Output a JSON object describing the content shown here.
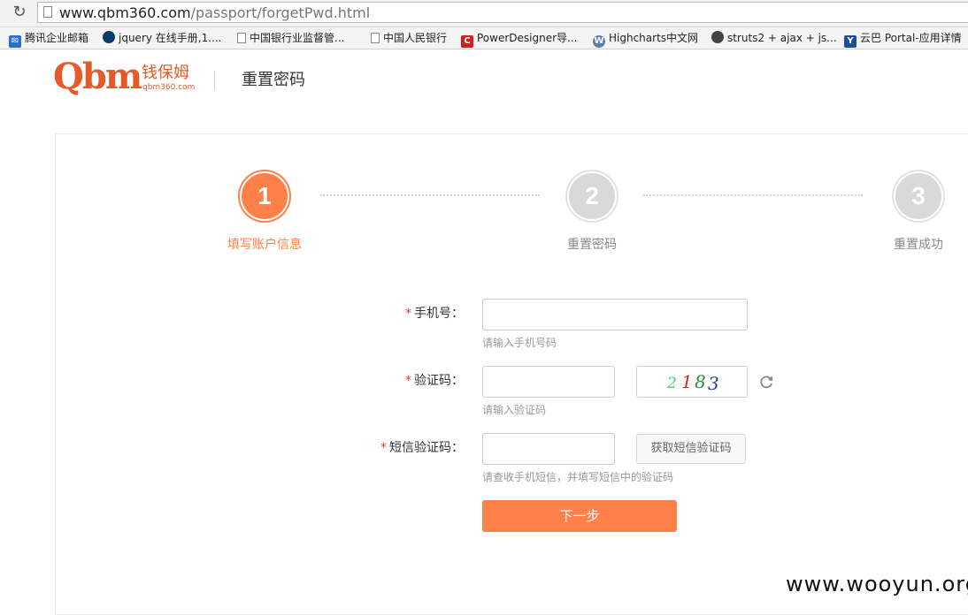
{
  "browser": {
    "url_host": "www.qbm360.com",
    "url_path": "/passport/forgetPwd.html",
    "bookmarks": [
      {
        "label": "腾讯企业邮箱",
        "icon": "mail-icon"
      },
      {
        "label": "jquery 在线手册,1....",
        "icon": "jquery-icon"
      },
      {
        "label": "中国银行业监督管...",
        "icon": "page-icon"
      },
      {
        "label": "中国人民银行",
        "icon": "page-icon"
      },
      {
        "label": "PowerDesigner导...",
        "icon": "powerdesigner-icon"
      },
      {
        "label": "Highcharts中文网",
        "icon": "highcharts-icon"
      },
      {
        "label": "struts2 + ajax + js...",
        "icon": "struts-icon"
      },
      {
        "label": "云巴 Portal-应用详情",
        "icon": "yunba-icon"
      }
    ]
  },
  "header": {
    "logo_text": "Qbm",
    "logo_cn": "钱保姆",
    "logo_domain": "qbm360.com",
    "title": "重置密码"
  },
  "steps": [
    {
      "number": "1",
      "label": "填写账户信息",
      "state": "active"
    },
    {
      "number": "2",
      "label": "重置密码",
      "state": "inactive"
    },
    {
      "number": "3",
      "label": "重置成功",
      "state": "inactive"
    }
  ],
  "form": {
    "required_mark": "*",
    "phone": {
      "label": "手机号：",
      "value": "",
      "hint": "请输入手机号码"
    },
    "captcha": {
      "label": "验证码：",
      "value": "",
      "hint": "请输入验证码",
      "image_text": [
        "2",
        "1",
        "8",
        "3"
      ]
    },
    "sms": {
      "label": "短信验证码：",
      "value": "",
      "hint": "请查收手机短信，并填写短信中的验证码",
      "button": "获取短信验证码"
    },
    "submit": "下一步"
  },
  "colors": {
    "accent": "#ff8048",
    "logo": "#e55a2a",
    "required": "#e53c2e"
  },
  "watermark": "www.wooyun.org"
}
